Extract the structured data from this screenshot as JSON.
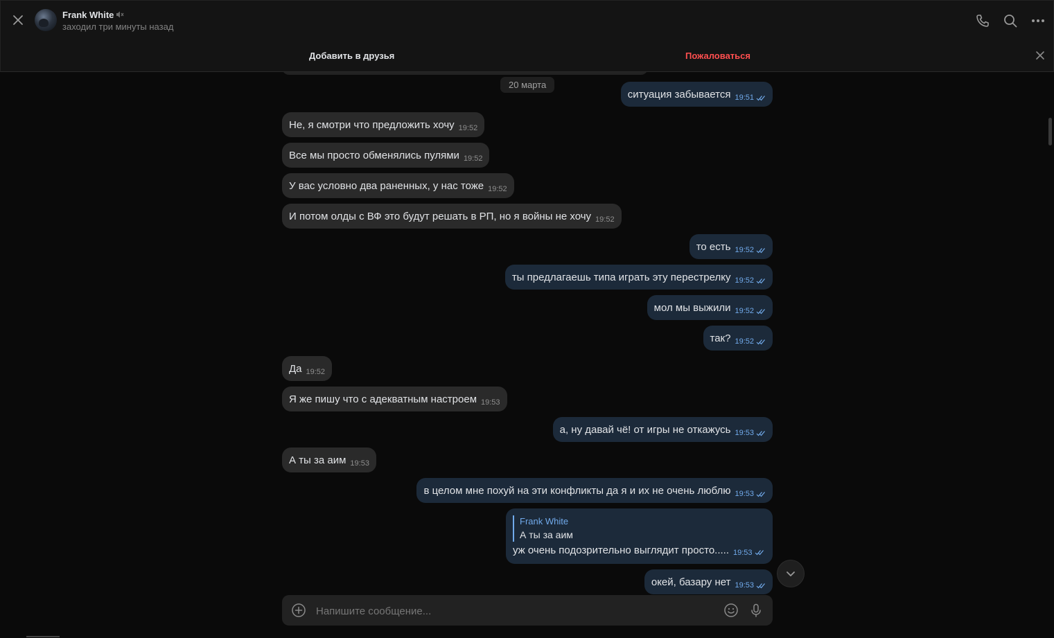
{
  "header": {
    "name": "Frank White",
    "status": "заходил три минуты назад",
    "icons": [
      "close-icon",
      "mute-icon",
      "phone-icon",
      "search-icon",
      "more-icon"
    ]
  },
  "friend_bar": {
    "add_friend": "Добавить в друзья",
    "report": "Пожаловаться"
  },
  "chat": {
    "date": "20 марта",
    "messages": [
      {
        "dir": "out",
        "text": "ситуация забывается",
        "time": "19:51"
      },
      {
        "dir": "in",
        "text": "Не, я смотри что предложить хочу",
        "time": "19:52"
      },
      {
        "dir": "in",
        "text": "Все мы просто обменялись пулями",
        "time": "19:52"
      },
      {
        "dir": "in",
        "text": "У вас условно два раненных, у нас тоже",
        "time": "19:52"
      },
      {
        "dir": "in",
        "text": "И потом олды с ВФ это будут решать в РП, но я войны не хочу",
        "time": "19:52"
      },
      {
        "dir": "out",
        "text": "то есть",
        "time": "19:52"
      },
      {
        "dir": "out",
        "text": "ты предлагаешь типа играть эту перестрелку",
        "time": "19:52"
      },
      {
        "dir": "out",
        "text": "мол мы выжили",
        "time": "19:52"
      },
      {
        "dir": "out",
        "text": "так?",
        "time": "19:52"
      },
      {
        "dir": "in",
        "text": "Да",
        "time": "19:52"
      },
      {
        "dir": "in",
        "text": "Я же пишу что с адекватным настроем",
        "time": "19:53"
      },
      {
        "dir": "out",
        "text": "а, ну давай чё! от игры не откажусь",
        "time": "19:53"
      },
      {
        "dir": "in",
        "text": "А ты за аим",
        "time": "19:53"
      },
      {
        "dir": "out",
        "text": "в целом мне похуй на эти конфликты да я и их не очень люблю",
        "time": "19:53"
      },
      {
        "dir": "out",
        "text": "окей, базару нет",
        "time": "19:53"
      }
    ],
    "reply": {
      "quote_author": "Frank White",
      "quote_text": "А ты за аим",
      "text": "уж очень подозрительно выглядит просто.....",
      "time": "19:53"
    }
  },
  "composer": {
    "placeholder": "Напишите сообщение...",
    "icons": [
      "attach-icon",
      "emoji-icon",
      "microphone-icon"
    ]
  },
  "colors": {
    "background": "#0a0a0a",
    "incoming_bubble": "#2a2a2a",
    "outgoing_bubble": "#1c2a3a",
    "accent": "#71aaeb",
    "report": "#ff4f4f"
  }
}
